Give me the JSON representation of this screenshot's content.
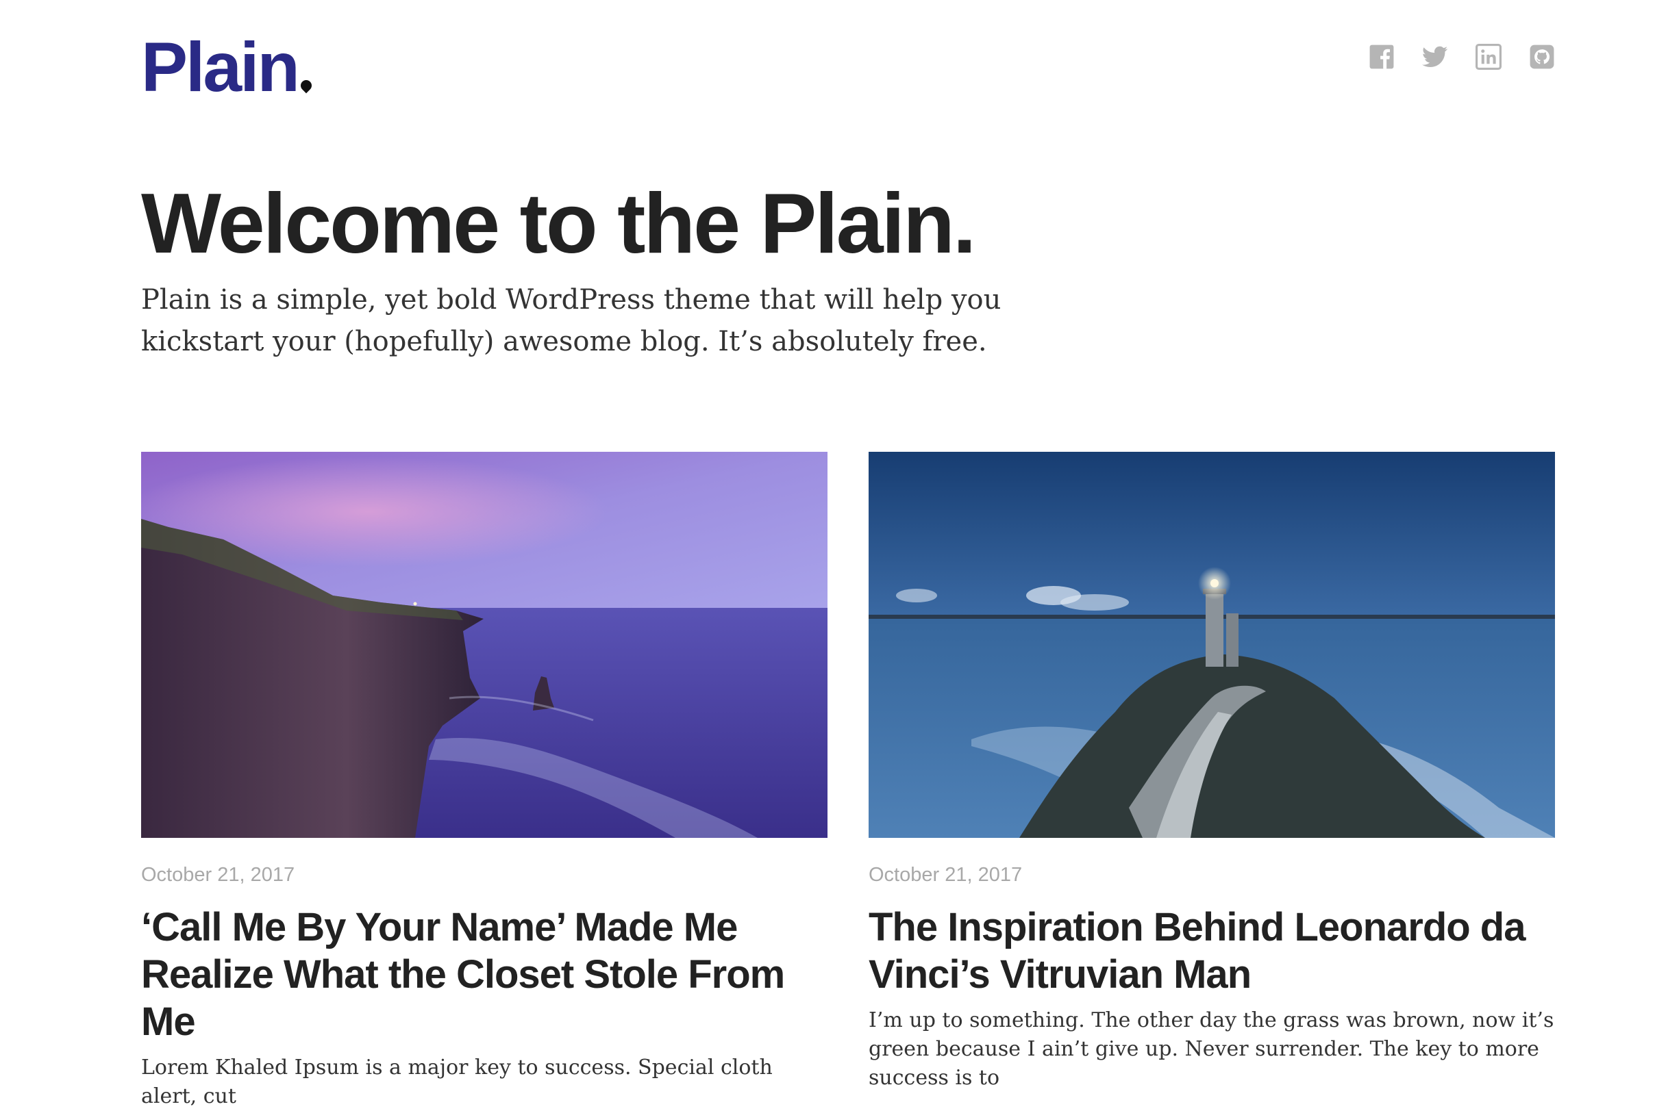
{
  "site": {
    "logo_text": "Plain",
    "brand_color": "#2a2a86",
    "social": [
      {
        "name": "facebook",
        "icon": "facebook-icon"
      },
      {
        "name": "twitter",
        "icon": "twitter-icon"
      },
      {
        "name": "linkedin",
        "icon": "linkedin-icon"
      },
      {
        "name": "github",
        "icon": "github-icon"
      }
    ]
  },
  "hero": {
    "title": "Welcome to the Plain.",
    "subtitle": "Plain is a simple, yet bold WordPress theme that will help you kickstart your (hopefully) awesome blog. It’s absolutely free."
  },
  "posts": [
    {
      "image": "cliffs-at-dusk-over-ocean",
      "date": "October 21, 2017",
      "title": "‘Call Me By Your Name’ Made Me Realize What the Closet Stole From Me",
      "excerpt": "Lorem Khaled Ipsum is a major key to success. Special cloth alert, cut"
    },
    {
      "image": "lighthouse-on-rocky-coast",
      "date": "October 21, 2017",
      "title": "The Inspiration Behind Leonardo da Vinci’s Vitruvian Man",
      "excerpt": "I’m up to something. The other day the grass was brown, now it’s green because I ain’t give up. Never surrender. The key to more success is to"
    }
  ]
}
